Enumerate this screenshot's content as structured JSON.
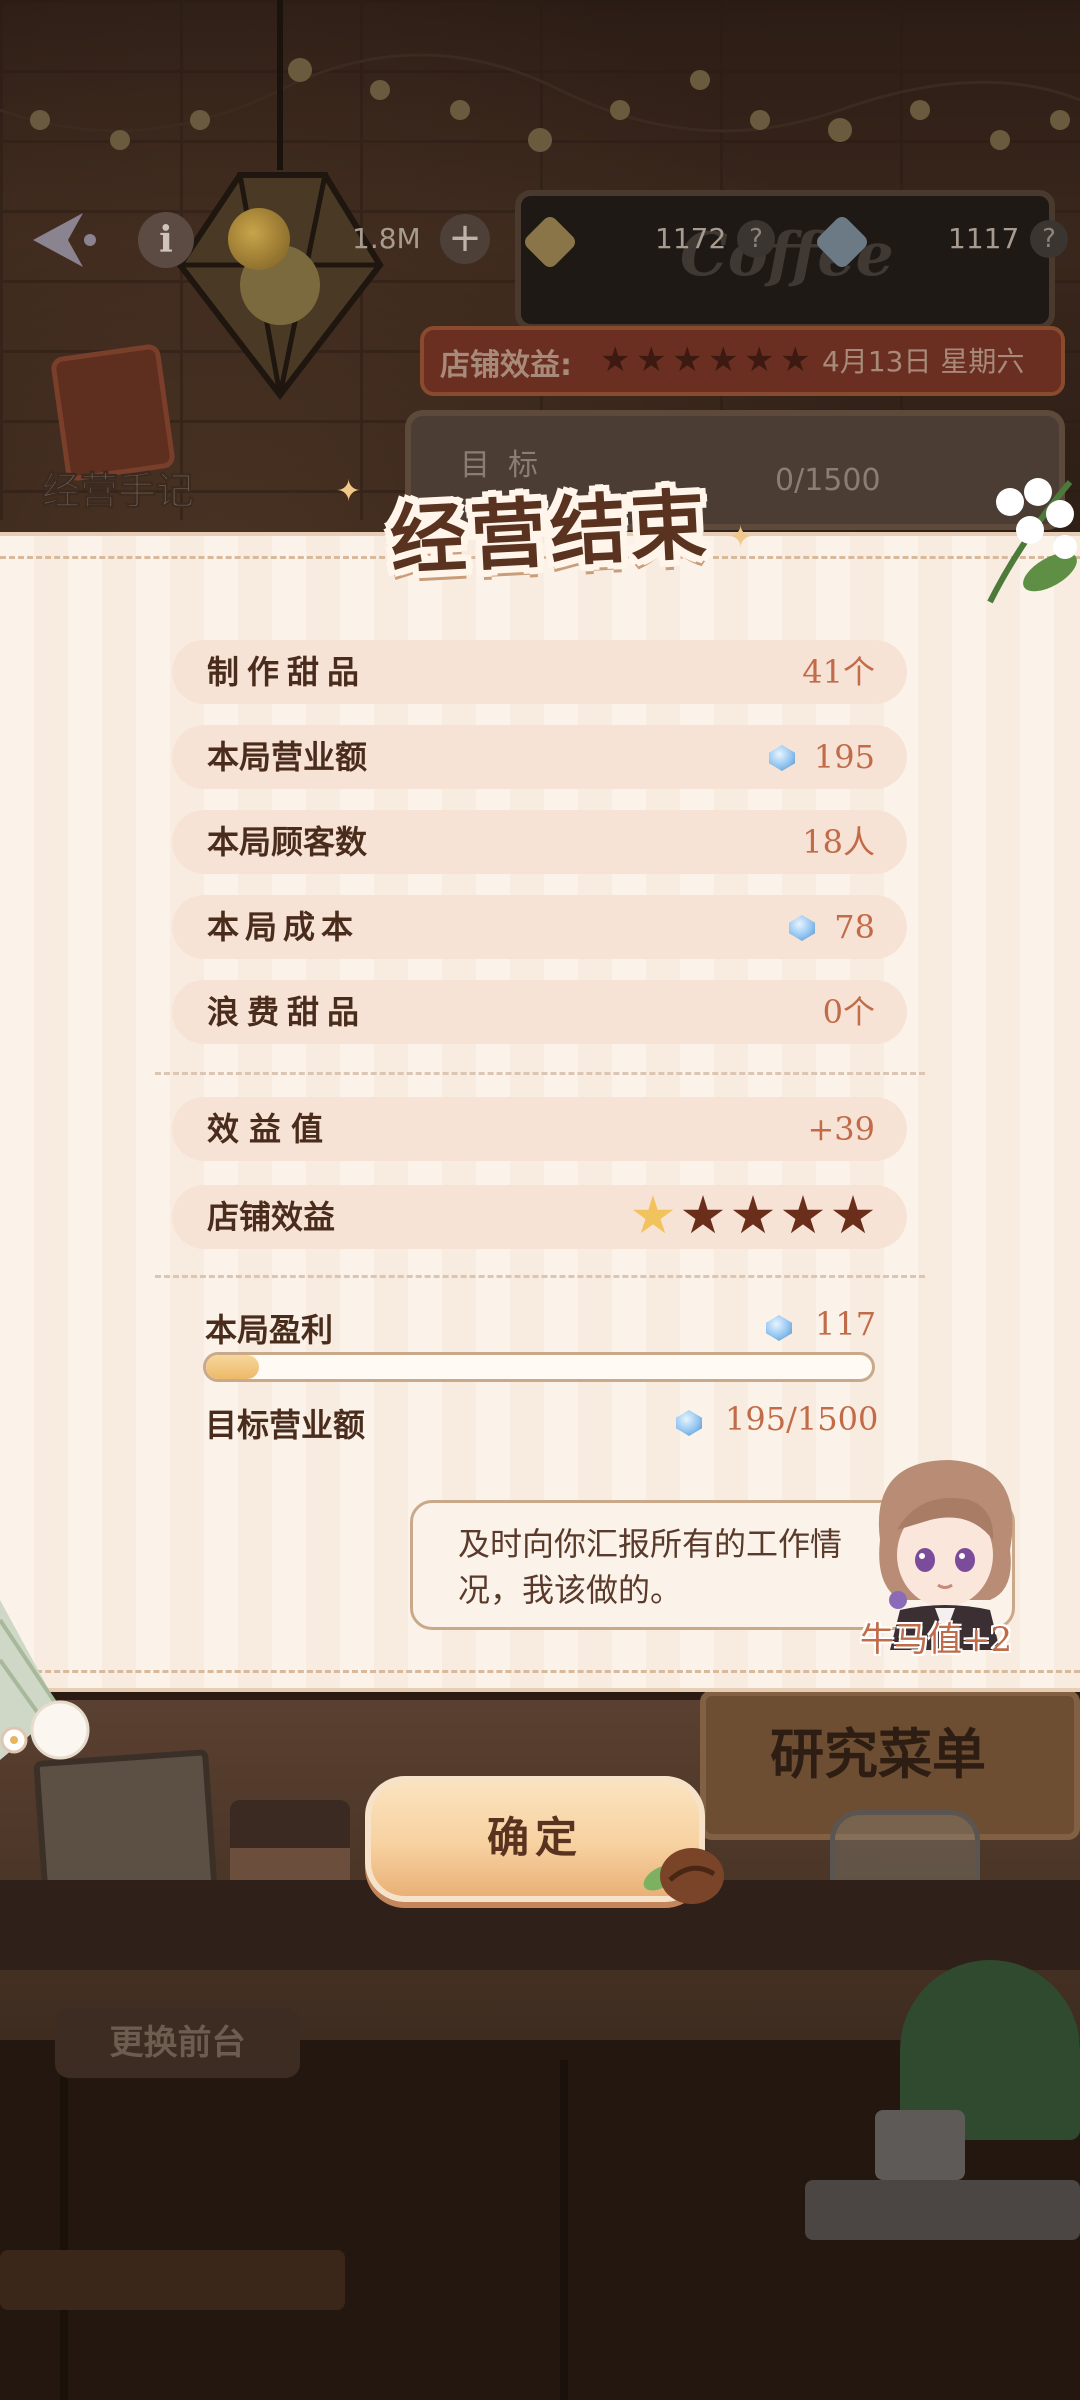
{
  "hud": {
    "gold_amount": "1.8M",
    "gem_amount_1": "1172",
    "gem_amount_2": "1117",
    "help_symbol": "?",
    "info_symbol": "i",
    "plus_symbol": "+"
  },
  "background": {
    "coffee_sign": "Coffee",
    "shop_efficiency_label": "店铺效益:",
    "date": "4月13日 星期六",
    "journal_label": "经营手记",
    "target_label": "目标",
    "target_progress": "0/1500",
    "research_menu_label": "研究菜单",
    "change_frontdesk_label": "更换前台"
  },
  "dialog": {
    "title": "经营结束",
    "stats": [
      {
        "label": "制作甜品",
        "value": "41个"
      },
      {
        "label": "本局营业额",
        "value": "195",
        "icon": "gem-icon"
      },
      {
        "label": "本局顾客数",
        "value": "18人"
      },
      {
        "label": "本局成本",
        "value": "78",
        "icon": "gem-icon"
      },
      {
        "label": "浪费甜品",
        "value": "0个"
      }
    ],
    "benefit_label": "效益值",
    "benefit_value": "+39",
    "shop_efficiency_label": "店铺效益",
    "shop_efficiency_stars": {
      "filled": 1,
      "total": 5
    },
    "profit_label": "本局盈利",
    "profit_value": "117",
    "profit_progress": 0.08,
    "target_revenue_label": "目标营业额",
    "target_revenue_value": "195/1500",
    "speech": "及时向你汇报所有的工作情况，我该做的。",
    "reward": "牛马值+2",
    "confirm_label": "确定"
  },
  "colors": {
    "accent_text": "#c26b48",
    "dark_text": "#4a2c1c",
    "row_bg": "#f7e3d6",
    "star_filled": "#f2c35c",
    "star_empty": "#6a2e1a"
  }
}
